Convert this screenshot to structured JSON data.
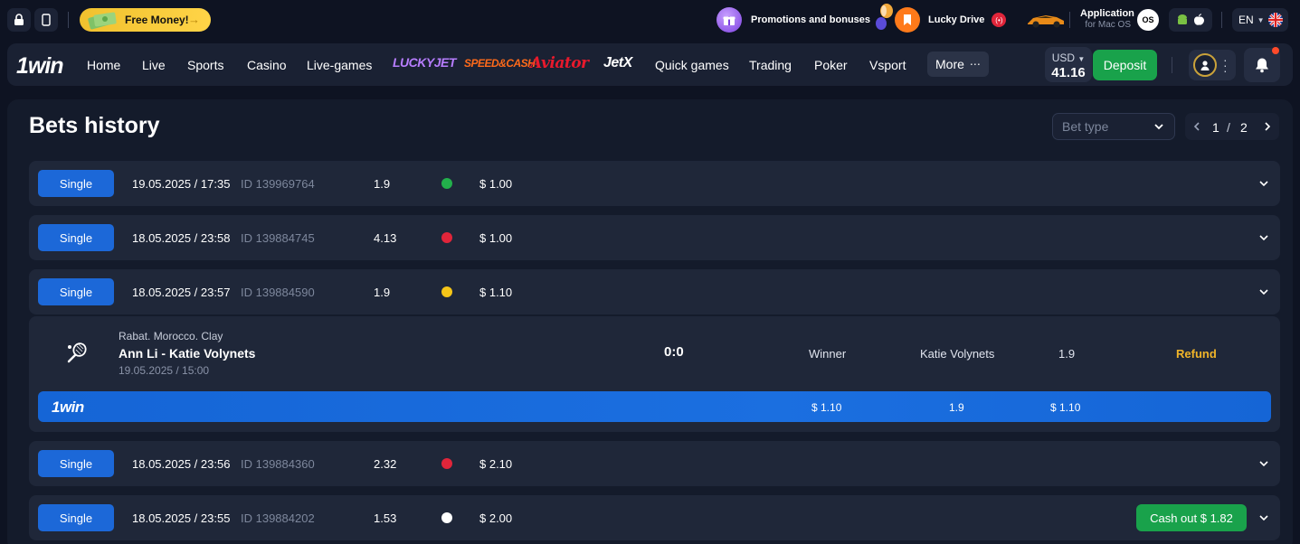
{
  "topbar": {
    "free_money": "Free Money!",
    "promotions": "Promotions and bonuses",
    "lucky_drive": "Lucky Drive",
    "live_badge": "(•)",
    "app_line1": "Application",
    "app_line2": "for Mac OS",
    "os_badge": "OS",
    "lang": "EN"
  },
  "nav": {
    "logo": "1win",
    "items": [
      "Home",
      "Live",
      "Sports",
      "Casino",
      "Live-games"
    ],
    "brands": [
      "LUCKYJET",
      "SPEED&CASH",
      "Aviator",
      "JetX"
    ],
    "items2": [
      "Quick games",
      "Trading",
      "Poker",
      "Vsport"
    ],
    "more": "More",
    "currency": "USD",
    "balance": "41.16",
    "deposit": "Deposit"
  },
  "page": {
    "title": "Bets history",
    "bet_type_placeholder": "Bet type",
    "page_current": "1",
    "page_sep": "/",
    "page_total": "2"
  },
  "bets": [
    {
      "type": "Single",
      "date": "19.05.2025 / 17:35",
      "id": "ID 139969764",
      "coef": "1.9",
      "status_color": "#22b04b",
      "amount": "$ 1.00"
    },
    {
      "type": "Single",
      "date": "18.05.2025 / 23:58",
      "id": "ID 139884745",
      "coef": "4.13",
      "status_color": "#e0253a",
      "amount": "$ 1.00"
    },
    {
      "type": "Single",
      "date": "18.05.2025 / 23:57",
      "id": "ID 139884590",
      "coef": "1.9",
      "status_color": "#f5c518",
      "amount": "$ 1.10"
    },
    {
      "type": "Single",
      "date": "18.05.2025 / 23:56",
      "id": "ID 139884360",
      "coef": "2.32",
      "status_color": "#e0253a",
      "amount": "$ 2.10"
    },
    {
      "type": "Single",
      "date": "18.05.2025 / 23:55",
      "id": "ID 139884202",
      "coef": "1.53",
      "status_color": "#ffffff",
      "amount": "$ 2.00",
      "cashout": "Cash out $ 1.82"
    }
  ],
  "detail": {
    "league": "Rabat. Morocco. Clay",
    "match": "Ann Li - Katie Volynets",
    "date": "19.05.2025 / 15:00",
    "score": "0:0",
    "market": "Winner",
    "pick": "Katie Volynets",
    "coef": "1.9",
    "status": "Refund",
    "summary_logo": "1win",
    "summary_stake": "$ 1.10",
    "summary_coef": "1.9",
    "summary_payout": "$ 1.10"
  }
}
